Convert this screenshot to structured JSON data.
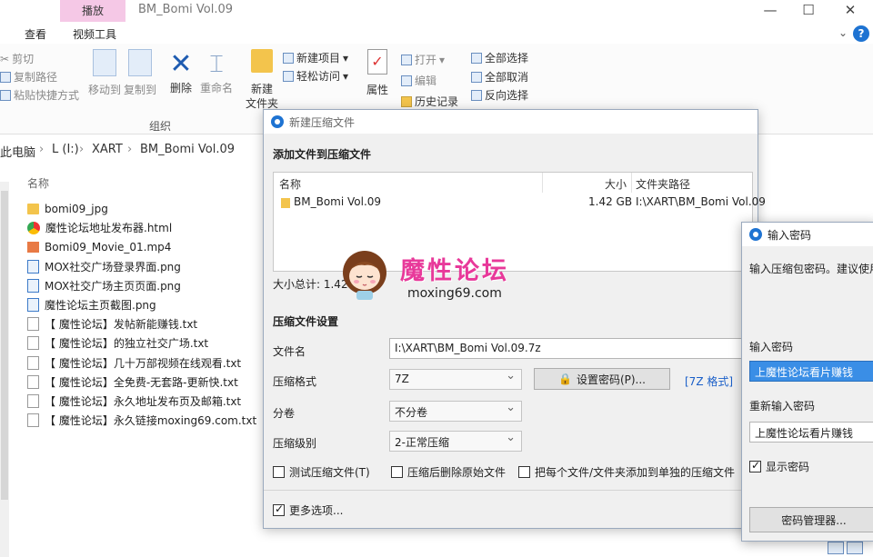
{
  "explorer": {
    "context_tab": "播放",
    "window_title": "BM_Bomi Vol.09",
    "tabs": [
      "查看",
      "视频工具"
    ],
    "ribbon": {
      "clipboard": {
        "cut": "剪切",
        "copy_path": "复制路径",
        "paste_shortcut": "粘贴快捷方式"
      },
      "organize": {
        "move_to": "移动到",
        "copy_to": "复制到",
        "delete": "删除",
        "rename": "重命名",
        "group_label": "组织"
      },
      "new": {
        "new_item": "新建项目",
        "easy_access": "轻松访问",
        "new_folder": "新建\n文件夹"
      },
      "open": {
        "properties": "属性",
        "open": "打开",
        "edit": "编辑",
        "history": "历史记录"
      },
      "select": {
        "select_all": "全部选择",
        "select_none": "全部取消",
        "invert": "反向选择"
      }
    },
    "address": [
      "此电脑",
      "L (I:)",
      "XART",
      "BM_Bomi Vol.09"
    ],
    "column_name": "名称",
    "files": [
      {
        "name": "bomi09_jpg",
        "type": "folder"
      },
      {
        "name": "魔性论坛地址发布器.html",
        "type": "html"
      },
      {
        "name": "Bomi09_Movie_01.mp4",
        "type": "mp4"
      },
      {
        "name": "MOX社交广场登录界面.png",
        "type": "png"
      },
      {
        "name": "MOX社交广场主页页面.png",
        "type": "png"
      },
      {
        "name": "魔性论坛主页截图.png",
        "type": "png"
      },
      {
        "name": "【 魔性论坛】发帖新能赚钱.txt",
        "type": "txt"
      },
      {
        "name": "【 魔性论坛】的独立社交广场.txt",
        "type": "txt"
      },
      {
        "name": "【 魔性论坛】几十万部视频在线观看.txt",
        "type": "txt"
      },
      {
        "name": "【 魔性论坛】全免费-无套路-更新快.txt",
        "type": "txt"
      },
      {
        "name": "【 魔性论坛】永久地址发布页及邮箱.txt",
        "type": "txt"
      },
      {
        "name": "【 魔性论坛】永久链接moxing69.com.txt",
        "type": "txt"
      }
    ]
  },
  "archive_dialog": {
    "title": "新建压缩文件",
    "section_add": "添加文件到压缩文件",
    "columns": {
      "name": "名称",
      "size": "大小",
      "path": "文件夹路径"
    },
    "row": {
      "name": "BM_Bomi Vol.09",
      "size": "1.42 GB",
      "path": "I:\\XART\\BM_Bomi Vol.09"
    },
    "total_label": "大小总计: 1.42",
    "section_settings": "压缩文件设置",
    "filename_label": "文件名",
    "filename_value": "I:\\XART\\BM_Bomi Vol.09.7z",
    "format_label": "压缩格式",
    "format_value": "7Z",
    "set_password_button": "设置密码(P)...",
    "format_link": "[7Z 格式]",
    "split_label": "分卷",
    "split_value": "不分卷",
    "level_label": "压缩级别",
    "level_value": "2-正常压缩",
    "test_checkbox": "测试压缩文件(T)",
    "delete_checkbox": "压缩后删除原始文件",
    "each_checkbox": "把每个文件/文件夹添加到单独的压缩文件",
    "more_options": "更多选项..."
  },
  "password_dialog": {
    "title": "输入密码",
    "hint": "输入压缩包密码。建议使用",
    "pw_label": "输入密码",
    "pw_value": "上魔性论坛看片赚钱",
    "repeat_label": "重新输入密码",
    "repeat_value": "上魔性论坛看片赚钱",
    "show_checkbox": "显示密码",
    "manager_button": "密码管理器..."
  },
  "watermark": {
    "title": "魔性论坛",
    "url": "moxing69.com"
  },
  "colors": {
    "accent": "#1e73d2",
    "watermark": "#e8399a",
    "context_tab": "#f5c8e6"
  }
}
